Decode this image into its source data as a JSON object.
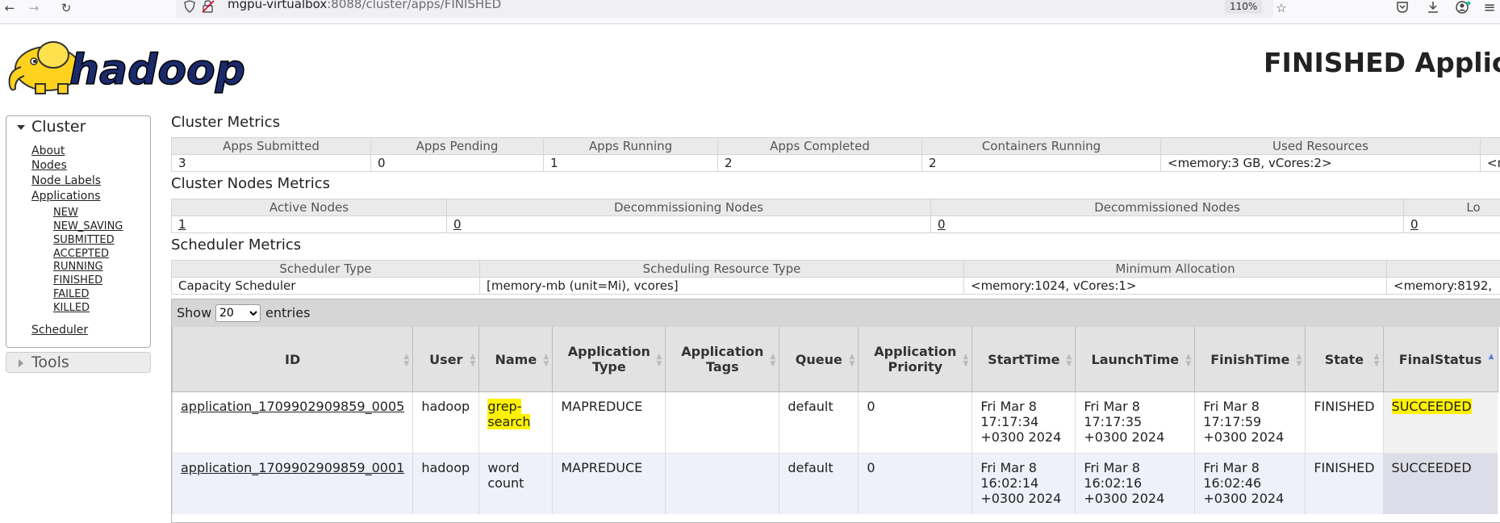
{
  "browser": {
    "url_host": "mgpu-virtualbox",
    "url_rest": ":8088/cluster/apps/FINISHED",
    "zoom": "110%"
  },
  "logo": {
    "text": "hadoop"
  },
  "page_title": "FINISHED Applica",
  "sidebar": {
    "cluster_label": "Cluster",
    "items": [
      "About",
      "Nodes",
      "Node Labels",
      "Applications"
    ],
    "app_states": [
      "NEW",
      "NEW_SAVING",
      "SUBMITTED",
      "ACCEPTED",
      "RUNNING",
      "FINISHED",
      "FAILED",
      "KILLED"
    ],
    "scheduler": "Scheduler",
    "tools_label": "Tools"
  },
  "cluster_metrics": {
    "title": "Cluster Metrics",
    "headers": [
      "Apps Submitted",
      "Apps Pending",
      "Apps Running",
      "Apps Completed",
      "Containers Running",
      "Used Resources",
      ""
    ],
    "values": [
      "3",
      "0",
      "1",
      "2",
      "2",
      "<memory:3 GB, vCores:2>",
      "<m"
    ]
  },
  "node_metrics": {
    "title": "Cluster Nodes Metrics",
    "headers": [
      "Active Nodes",
      "Decommissioning Nodes",
      "Decommissioned Nodes",
      "Lo"
    ],
    "values": [
      "1",
      "0",
      "0",
      "0"
    ]
  },
  "scheduler_metrics": {
    "title": "Scheduler Metrics",
    "headers": [
      "Scheduler Type",
      "Scheduling Resource Type",
      "Minimum Allocation",
      ""
    ],
    "values": [
      "Capacity Scheduler",
      "[memory-mb (unit=Mi), vcores]",
      "<memory:1024, vCores:1>",
      "<memory:8192,"
    ]
  },
  "apps": {
    "show_label": "Show",
    "entries_label": "entries",
    "page_size": "20",
    "columns": [
      "ID",
      "User",
      "Name",
      "Application Type",
      "Application Tags",
      "Queue",
      "Application Priority",
      "StartTime",
      "LaunchTime",
      "FinishTime",
      "State",
      "FinalStatus"
    ],
    "rows": [
      {
        "id": "application_1709902909859_0005",
        "user": "hadoop",
        "name": "grep-search",
        "type": "MAPREDUCE",
        "tags": "",
        "queue": "default",
        "priority": "0",
        "start": "Fri Mar 8 17:17:34 +0300 2024",
        "launch": "Fri Mar 8 17:17:35 +0300 2024",
        "finish": "Fri Mar 8 17:17:59 +0300 2024",
        "state": "FINISHED",
        "final_status": "SUCCEEDED"
      },
      {
        "id": "application_1709902909859_0001",
        "user": "hadoop",
        "name": "word count",
        "type": "MAPREDUCE",
        "tags": "",
        "queue": "default",
        "priority": "0",
        "start": "Fri Mar 8 16:02:14 +0300 2024",
        "launch": "Fri Mar 8 16:02:16 +0300 2024",
        "finish": "Fri Mar 8 16:02:46 +0300 2024",
        "state": "FINISHED",
        "final_status": "SUCCEEDED"
      }
    ]
  }
}
